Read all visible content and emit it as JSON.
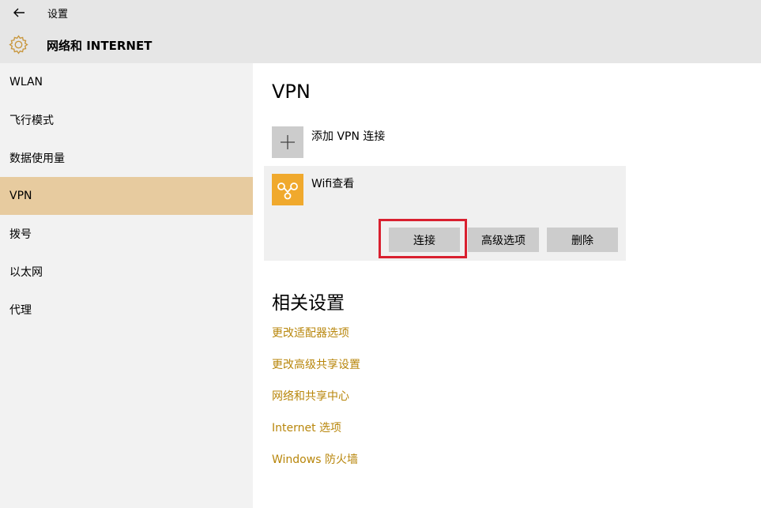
{
  "window": {
    "title": "设置",
    "back_icon": "back-arrow-icon"
  },
  "header": {
    "icon": "gear-icon",
    "title": "网络和 INTERNET"
  },
  "sidebar": {
    "items": [
      {
        "label": "WLAN",
        "active": false
      },
      {
        "label": "飞行模式",
        "active": false
      },
      {
        "label": "数据使用量",
        "active": false
      },
      {
        "label": "VPN",
        "active": true
      },
      {
        "label": "拨号",
        "active": false
      },
      {
        "label": "以太网",
        "active": false
      },
      {
        "label": "代理",
        "active": false
      }
    ]
  },
  "main": {
    "title": "VPN",
    "add_vpn": {
      "label": "添加 VPN 连接",
      "icon": "plus-icon"
    },
    "vpn_connection": {
      "name": "Wifi查看",
      "icon": "vpn-link-icon",
      "icon_color": "#f0a92d",
      "buttons": {
        "connect": "连接",
        "advanced": "高级选项",
        "delete": "删除"
      }
    },
    "related": {
      "title": "相关设置",
      "links": [
        "更改适配器选项",
        "更改高级共享设置",
        "网络和共享中心",
        "Internet 选项",
        "Windows 防火墙"
      ]
    }
  },
  "colors": {
    "accent": "#b8860b",
    "active_nav": "#e7cb9f",
    "highlight": "#d9202f"
  }
}
